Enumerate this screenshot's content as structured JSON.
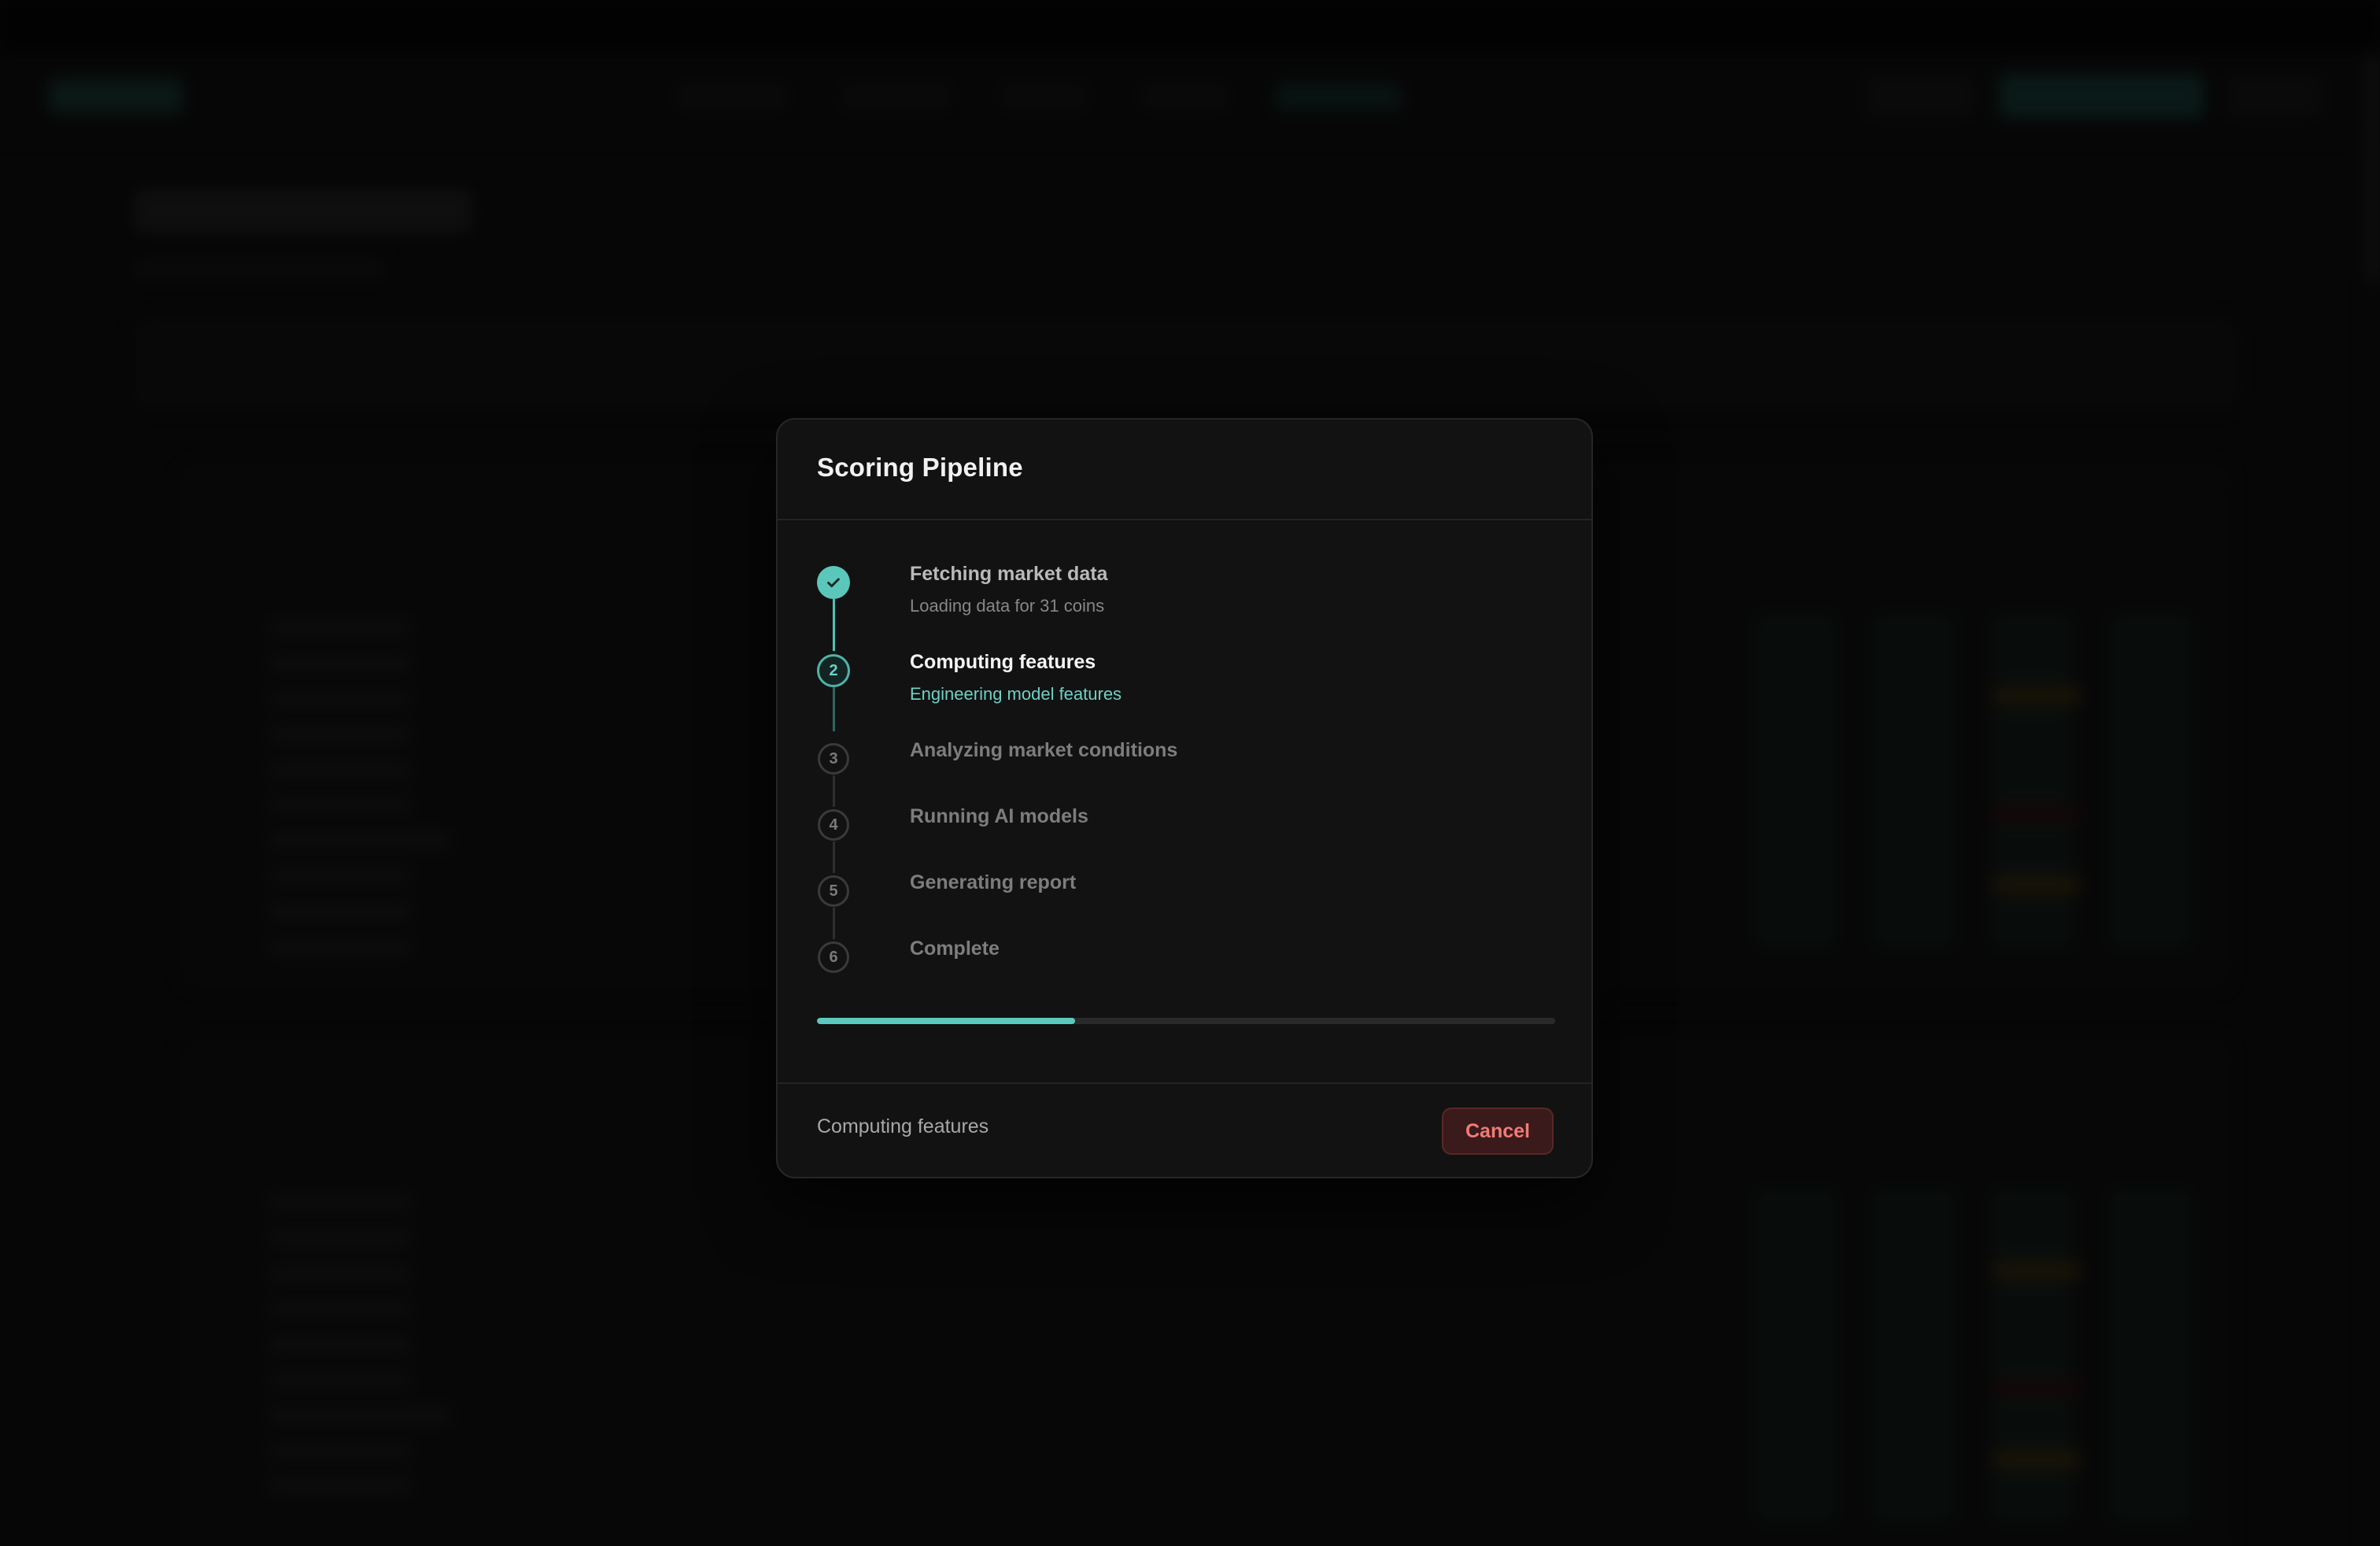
{
  "modal": {
    "title": "Scoring Pipeline",
    "steps": [
      {
        "number": "1",
        "title": "Fetching market data",
        "subtitle": "Loading data for 31 coins",
        "status": "done"
      },
      {
        "number": "2",
        "title": "Computing features",
        "subtitle": "Engineering model features",
        "status": "active"
      },
      {
        "number": "3",
        "title": "Analyzing market conditions",
        "subtitle": "",
        "status": "pending"
      },
      {
        "number": "4",
        "title": "Running AI models",
        "subtitle": "",
        "status": "pending"
      },
      {
        "number": "5",
        "title": "Generating report",
        "subtitle": "",
        "status": "pending"
      },
      {
        "number": "6",
        "title": "Complete",
        "subtitle": "",
        "status": "pending"
      }
    ],
    "progress_fraction": 0.35,
    "footer": {
      "status_text": "Computing features",
      "cancel_label": "Cancel"
    }
  },
  "colors": {
    "accent": "#5bc9bd",
    "danger": "#f07b78",
    "modal_bg": "#121212"
  },
  "icons": {
    "done_step": "check-icon"
  }
}
